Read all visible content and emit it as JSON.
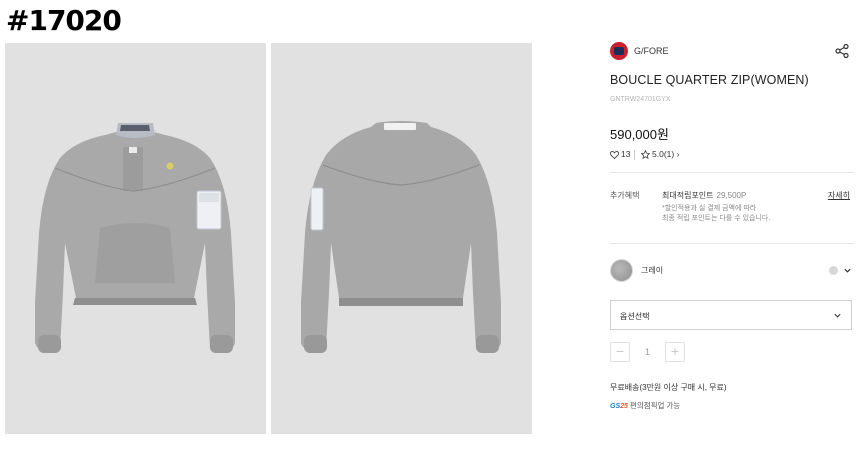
{
  "tag": "#17020",
  "images": [
    {
      "name": "sweater-front-image"
    },
    {
      "name": "sweater-back-image"
    }
  ],
  "brand": {
    "name": "G/FORE"
  },
  "product": {
    "title": "BOUCLE QUARTER ZIP(WOMEN)",
    "code": "GNTRW24701GYX",
    "price": "590,000원"
  },
  "stats": {
    "likes": "13",
    "rating": "5.0(1)"
  },
  "benefits": {
    "label": "추가혜택",
    "title": "최대적립포인트",
    "points": "29,500P",
    "note_line1": "*할인적용과 실 결제 금액에 따라",
    "note_line2": "최종 적립 포인트는 다를 수 있습니다.",
    "more": "자세히"
  },
  "color": {
    "name": "그레이",
    "swatch": "#a3a3a3"
  },
  "option": {
    "placeholder": "옵션선택"
  },
  "quantity": {
    "minus": "−",
    "value": "1",
    "plus": "+"
  },
  "shipping": {
    "text": "무료배송(3만원 이상 구매 시, 무료)"
  },
  "store_pickup": {
    "logo_a": "GS",
    "logo_b": "25",
    "text": "편의점픽업 가능"
  },
  "colors": {
    "background": "#ffffff",
    "photo_bg": "#e1e1e1",
    "text": "#222222"
  }
}
